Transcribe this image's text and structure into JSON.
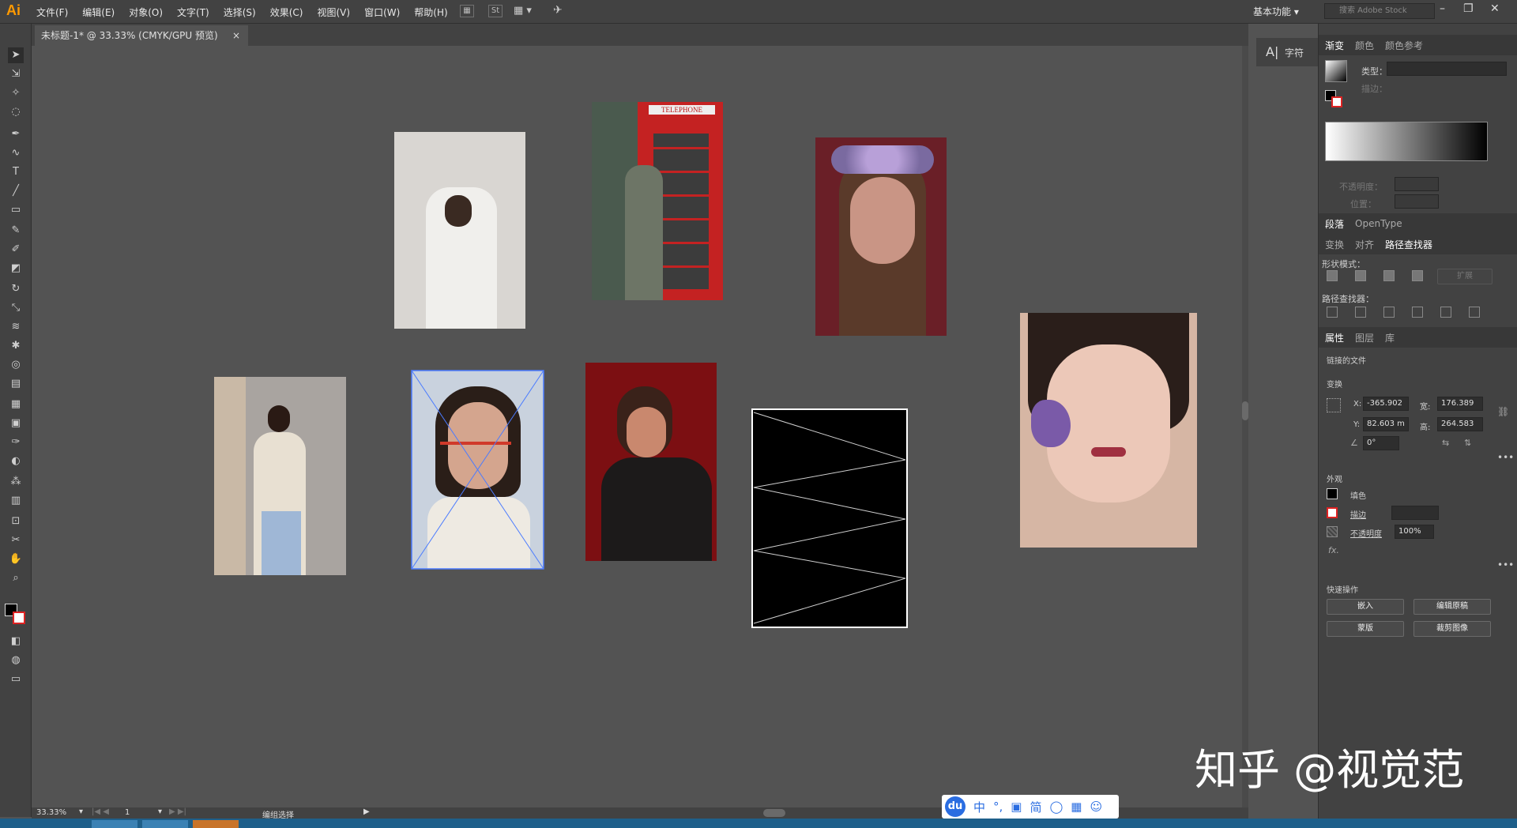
{
  "app": {
    "logo": "Ai"
  },
  "menubar": {
    "items": [
      "文件(F)",
      "编辑(E)",
      "对象(O)",
      "文字(T)",
      "选择(S)",
      "效果(C)",
      "视图(V)",
      "窗口(W)",
      "帮助(H)"
    ],
    "st_label": "St",
    "workspace": "基本功能",
    "search_placeholder": "搜索 Adobe Stock"
  },
  "document_tab": {
    "title": "未标题-1* @ 33.33% (CMYK/GPU 预览)",
    "close": "×"
  },
  "canvas": {
    "phone_booth_sign": "TELEPHONE"
  },
  "statusbar": {
    "zoom": "33.33%",
    "artboard": "1",
    "mode": "编组选择"
  },
  "char_panel": {
    "label": "字符"
  },
  "gradient_panel": {
    "tabs": [
      "渐变",
      "颜色",
      "颜色参考"
    ],
    "type_label": "类型：",
    "stroke_label": "描边：",
    "opacity_label": "不透明度：",
    "position_label": "位置："
  },
  "paragraph_panel": {
    "tabs": [
      "段落",
      "OpenType"
    ]
  },
  "pathfinder_panel": {
    "tabs": [
      "变换",
      "对齐",
      "路径查找器"
    ],
    "shape_modes_label": "形状模式：",
    "expand_label": "扩展",
    "pathfinders_label": "路径查找器："
  },
  "properties_panel": {
    "tabs": [
      "属性",
      "图层",
      "库"
    ],
    "linked_file": "链接的文件",
    "transform_label": "变换",
    "x_label": "X:",
    "x_value": "-365.902",
    "y_label": "Y:",
    "y_value": "82.603 m",
    "w_label": "宽:",
    "w_value": "176.389",
    "h_label": "高:",
    "h_value": "264.583",
    "angle_value": "0°",
    "appearance_label": "外观",
    "fill_label": "填色",
    "stroke_label": "描边",
    "opacity_label": "不透明度",
    "opacity_value": "100%",
    "fx_label": "fx.",
    "quick_actions_label": "快速操作",
    "btn_embed": "嵌入",
    "btn_edit_original": "编辑原稿",
    "btn_mask": "蒙版",
    "btn_crop_image": "裁剪图像"
  },
  "ime": {
    "logo": "du",
    "items": [
      "中",
      "°,",
      "简"
    ]
  },
  "watermark": "知乎 @视觉范"
}
